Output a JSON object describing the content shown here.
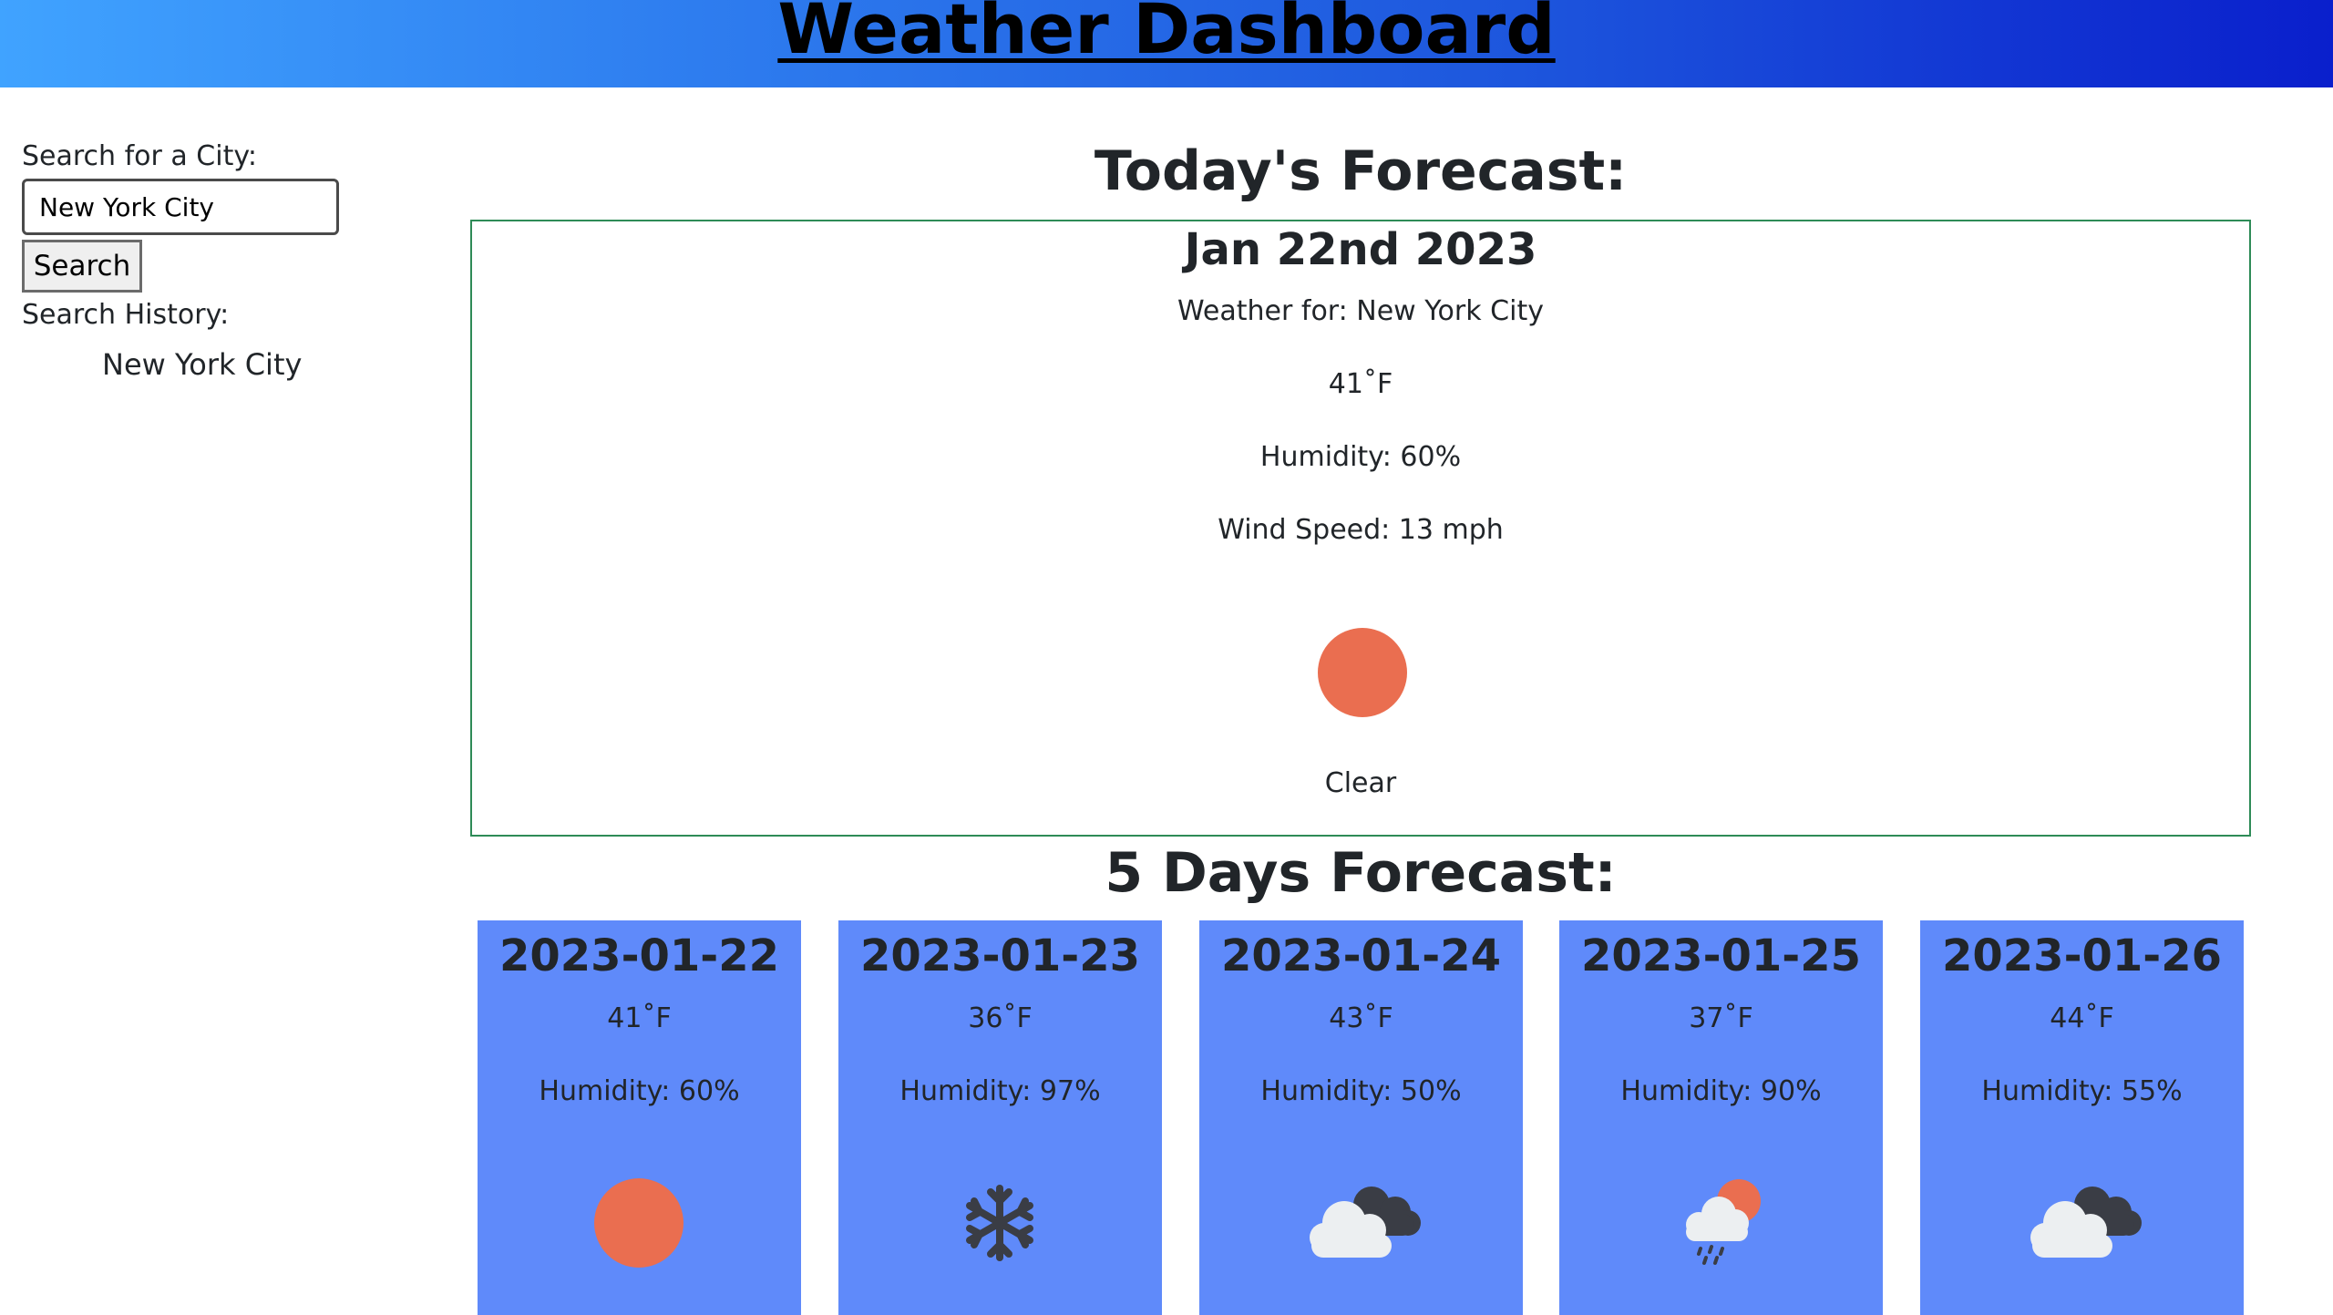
{
  "header": {
    "title": "Weather Dashboard"
  },
  "sidebar": {
    "search_label": "Search for a City:",
    "search_value": "New York City",
    "search_button": "Search",
    "history_label": "Search History:",
    "history": [
      "New York City"
    ]
  },
  "today": {
    "heading": "Today's Forecast:",
    "date": "Jan 22nd 2023",
    "city_line": "Weather for: New York City",
    "temperature": "41˚F",
    "humidity": "Humidity: 60%",
    "wind": "Wind Speed: 13 mph",
    "condition": "Clear",
    "icon": "sun-icon"
  },
  "forecast": {
    "heading": "5 Days Forecast:",
    "days": [
      {
        "date": "2023-01-22",
        "temperature": "41˚F",
        "humidity": "Humidity: 60%",
        "icon": "sun-icon"
      },
      {
        "date": "2023-01-23",
        "temperature": "36˚F",
        "humidity": "Humidity: 97%",
        "icon": "snowflake-icon"
      },
      {
        "date": "2023-01-24",
        "temperature": "43˚F",
        "humidity": "Humidity: 50%",
        "icon": "cloudy-icon"
      },
      {
        "date": "2023-01-25",
        "temperature": "37˚F",
        "humidity": "Humidity: 90%",
        "icon": "rain-sun-cloud-icon"
      },
      {
        "date": "2023-01-26",
        "temperature": "44˚F",
        "humidity": "Humidity: 55%",
        "icon": "cloudy-icon"
      }
    ]
  },
  "colors": {
    "card_background": "#5f8afa",
    "sun": "#ea6e50",
    "today_border": "#2e8b57"
  }
}
